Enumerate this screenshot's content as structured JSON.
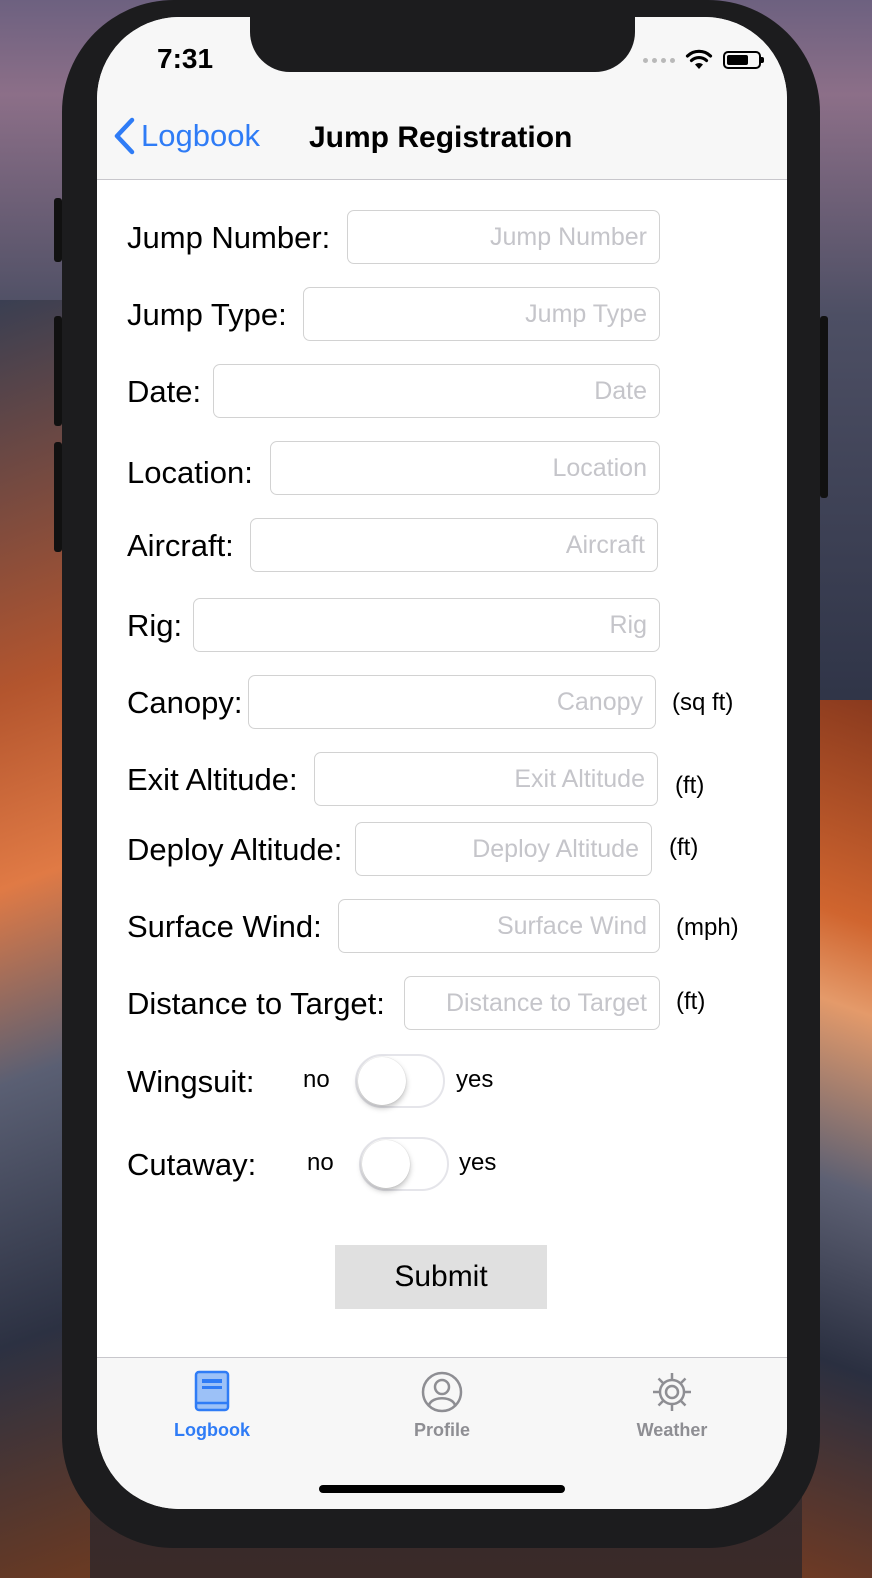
{
  "status": {
    "time": "7:31"
  },
  "nav": {
    "back_label": "Logbook",
    "title": "Jump Registration"
  },
  "form": {
    "fields": [
      {
        "label": "Jump Number:",
        "placeholder": "Jump Number",
        "value": ""
      },
      {
        "label": "Jump Type:",
        "placeholder": "Jump Type",
        "value": ""
      },
      {
        "label": "Date:",
        "placeholder": "Date",
        "value": ""
      },
      {
        "label": "Location:",
        "placeholder": "Location",
        "value": ""
      },
      {
        "label": "Aircraft:",
        "placeholder": "Aircraft",
        "value": ""
      },
      {
        "label": "Rig:",
        "placeholder": "Rig",
        "value": ""
      },
      {
        "label": "Canopy:",
        "placeholder": "Canopy",
        "value": "",
        "unit": "(sq ft)"
      },
      {
        "label": "Exit Altitude:",
        "placeholder": "Exit Altitude",
        "value": "",
        "unit": "(ft)"
      },
      {
        "label": "Deploy Altitude:",
        "placeholder": "Deploy Altitude",
        "value": "",
        "unit": "(ft)"
      },
      {
        "label": "Surface Wind:",
        "placeholder": "Surface Wind",
        "value": "",
        "unit": "(mph)"
      },
      {
        "label": "Distance to Target:",
        "placeholder": "Distance to Target",
        "value": "",
        "unit": "(ft)"
      }
    ],
    "switches": [
      {
        "label": "Wingsuit:",
        "off_label": "no",
        "on_label": "yes",
        "value": false
      },
      {
        "label": "Cutaway:",
        "off_label": "no",
        "on_label": "yes",
        "value": false
      }
    ],
    "submit_label": "Submit"
  },
  "tabbar": {
    "items": [
      {
        "label": "Logbook",
        "icon": "book-icon",
        "active": true
      },
      {
        "label": "Profile",
        "icon": "profile-icon",
        "active": false
      },
      {
        "label": "Weather",
        "icon": "gear-icon",
        "active": false
      }
    ],
    "active_color": "#2f7cf6",
    "inactive_color": "#8e8e93"
  }
}
